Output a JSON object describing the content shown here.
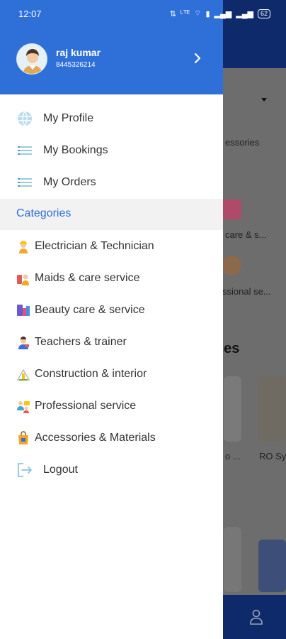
{
  "status_bar": {
    "time": "12:07",
    "right_icons": [
      "data-speed-icon",
      "volte-icon",
      "wifi-icon",
      "sim-icon",
      "signal-icon",
      "signal-icon"
    ],
    "battery": "62"
  },
  "background_app": {
    "partial_texts": [
      "essories",
      "care & s...",
      "ssional se...",
      "ces",
      "o ...",
      "RO Sy"
    ]
  },
  "drawer": {
    "user": {
      "name": "raj kumar",
      "phone": "8445326214",
      "avatar_icon": "avatar-icon",
      "chevron_icon": "chevron-right-icon"
    },
    "main_items": [
      {
        "label": "My Profile",
        "icon": "globe-icon"
      },
      {
        "label": "My Bookings",
        "icon": "list-icon"
      },
      {
        "label": "My Orders",
        "icon": "list-icon"
      }
    ],
    "categories_title": "Categories",
    "categories": [
      {
        "label": "Electrician & Technician",
        "icon": "electrician-icon"
      },
      {
        "label": "Maids & care service",
        "icon": "maid-icon"
      },
      {
        "label": "Beauty care & service",
        "icon": "beauty-icon"
      },
      {
        "label": "Teachers & trainer",
        "icon": "teacher-icon"
      },
      {
        "label": "Construction & interior",
        "icon": "construction-icon"
      },
      {
        "label": "Professional service",
        "icon": "professional-icon"
      },
      {
        "label": "Accessories & Materials",
        "icon": "accessories-icon"
      }
    ],
    "logout": {
      "label": "Logout",
      "icon": "logout-icon"
    }
  },
  "colors": {
    "primary": "#2e6fd8",
    "scrim": "#5a5a5a",
    "bg_header": "#0f2a6b",
    "category_header_bg": "#f2f2f2",
    "text": "#333333"
  }
}
